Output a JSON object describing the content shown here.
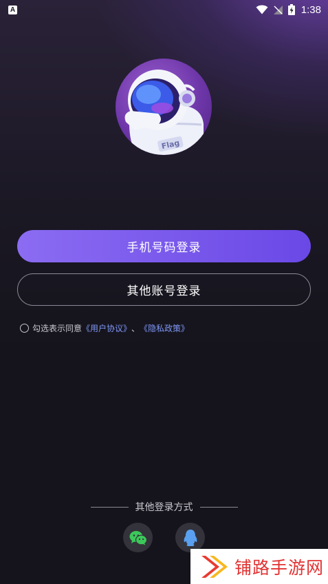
{
  "status_bar": {
    "notification_icon": "A",
    "time": "1:38"
  },
  "login": {
    "phone_login_label": "手机号码登录",
    "other_account_label": "其他账号登录",
    "agreement_prefix": "勾选表示同意",
    "user_agreement_link": "《用户协议》",
    "separator": "、",
    "privacy_policy_link": "《隐私政策》"
  },
  "other_login": {
    "title": "其他登录方式",
    "methods": [
      {
        "name": "wechat",
        "icon": "wechat-icon",
        "color": "#3cc85a"
      },
      {
        "name": "qq",
        "icon": "qq-penguin-icon",
        "color": "#5aa0f0"
      }
    ]
  },
  "mascot": {
    "badge_text": "Flag"
  },
  "watermark": {
    "text": "铺路手游网"
  },
  "colors": {
    "primary_button": "#7b5cf0",
    "link": "#7f97f5",
    "background": "#15141c"
  }
}
